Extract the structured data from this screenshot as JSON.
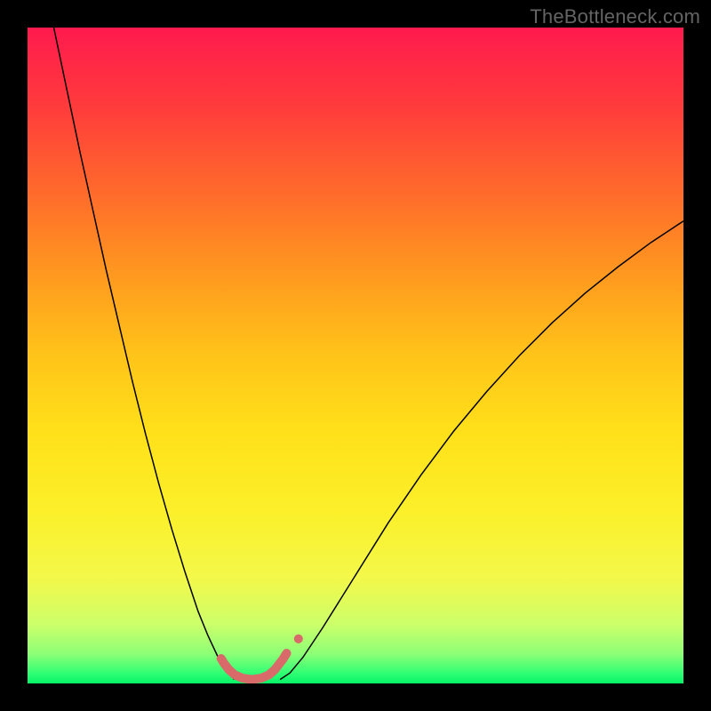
{
  "watermark": "TheBottleneck.com",
  "chart_data": {
    "type": "line",
    "title": "",
    "xlabel": "",
    "ylabel": "",
    "xlim": [
      0,
      100
    ],
    "ylim": [
      0,
      100
    ],
    "grid": false,
    "background_gradient_top_to_bottom": [
      "#ff1a4e",
      "#ff3b3c",
      "#ff6a2b",
      "#ff9a1f",
      "#ffc419",
      "#ffe11a",
      "#fbf02a",
      "#f3f84a",
      "#ccff6a",
      "#8dff76",
      "#2eff74",
      "#07f368"
    ],
    "series": [
      {
        "name": "left-limb",
        "type": "line",
        "color": "#000000",
        "width": 1.5,
        "x": [
          4,
          6,
          8,
          10,
          12,
          14,
          16,
          18,
          20,
          22,
          24,
          26,
          27.5,
          29,
          30.5,
          31.5
        ],
        "y": [
          100,
          90.5,
          81,
          72,
          63,
          54.5,
          46,
          38,
          30.5,
          23.5,
          17,
          11,
          7.3,
          4.1,
          1.8,
          0.6
        ]
      },
      {
        "name": "right-limb",
        "type": "line",
        "color": "#000000",
        "width": 1.5,
        "x": [
          38.5,
          40,
          42,
          45,
          50,
          55,
          60,
          65,
          70,
          75,
          80,
          85,
          90,
          95,
          100
        ],
        "y": [
          0.6,
          1.6,
          4.0,
          8.5,
          16.5,
          24.5,
          31.8,
          38.5,
          44.5,
          50.0,
          55.0,
          59.5,
          63.5,
          67.2,
          70.5
        ]
      },
      {
        "name": "marker-band",
        "type": "line",
        "color": "#d86a6a",
        "width": 10,
        "linecap": "round",
        "x": [
          29.5,
          30.0,
          30.7,
          31.6,
          32.8,
          34.2,
          35.6,
          36.8,
          37.7,
          38.4,
          39.0,
          39.5
        ],
        "y": [
          3.8,
          3.0,
          2.1,
          1.3,
          0.8,
          0.6,
          0.8,
          1.3,
          2.1,
          3.0,
          3.8,
          4.6
        ]
      },
      {
        "name": "marker-dot-right",
        "type": "scatter",
        "color": "#d86a6a",
        "radius": 5,
        "x": [
          41.3
        ],
        "y": [
          6.8
        ]
      }
    ]
  }
}
